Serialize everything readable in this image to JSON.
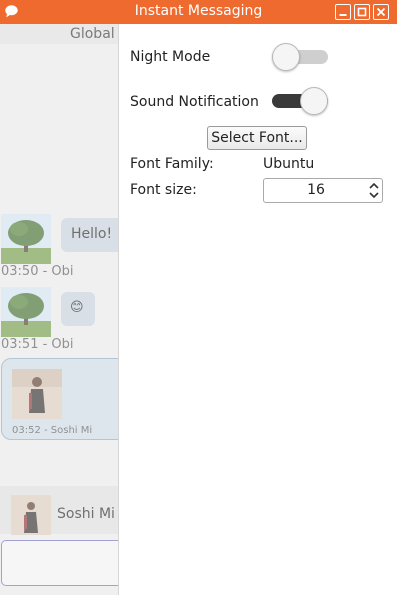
{
  "window": {
    "title": "Instant Messaging",
    "title_bar_color": "#ef6a2e"
  },
  "chat": {
    "header_label": "Global",
    "messages": [
      {
        "text": "Hello!",
        "meta": "03:50 - Obi"
      },
      {
        "text": "😊",
        "meta": "03:51 - Obi"
      },
      {
        "meta": "03:52 - Soshi Mi",
        "kind": "photo"
      }
    ],
    "user_entry": {
      "name": "Soshi Mi"
    }
  },
  "settings": {
    "night_mode": {
      "label": "Night Mode",
      "enabled": false
    },
    "sound_notification": {
      "label": "Sound Notification",
      "enabled": true
    },
    "select_font_button": "Select Font...",
    "font_family": {
      "label": "Font Family:",
      "value": "Ubuntu"
    },
    "font_size": {
      "label": "Font size:",
      "value": "16"
    }
  }
}
